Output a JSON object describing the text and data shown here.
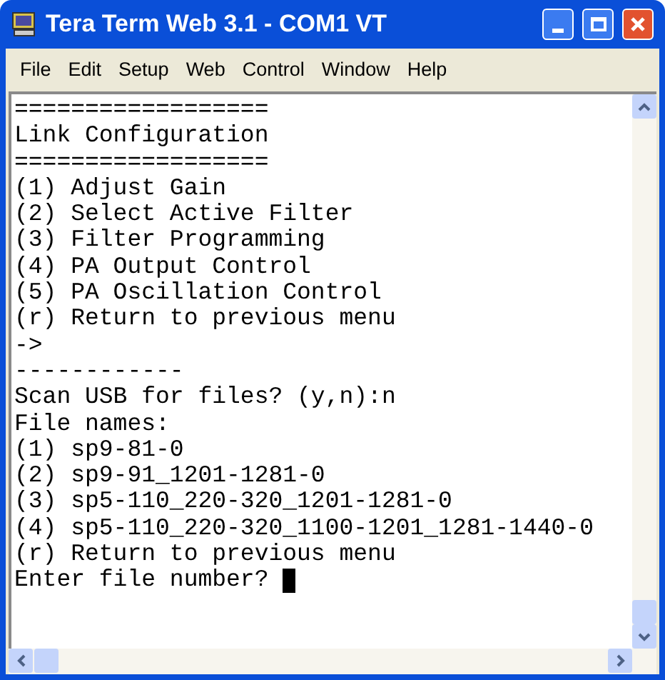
{
  "window": {
    "title": "Tera Term Web 3.1 - COM1 VT"
  },
  "menu": [
    "File",
    "Edit",
    "Setup",
    "Web",
    "Control",
    "Window",
    "Help"
  ],
  "terminal": {
    "lines": [
      "==================",
      "Link Configuration",
      "==================",
      "(1) Adjust Gain",
      "(2) Select Active Filter",
      "(3) Filter Programming",
      "(4) PA Output Control",
      "(5) PA Oscillation Control",
      "(r) Return to previous menu",
      "->",
      "------------",
      "Scan USB for files? (y,n):n",
      "File names:",
      "(1) sp9-81-0",
      "(2) sp9-91_1201-1281-0",
      "(3) sp5-110_220-320_1201-1281-0",
      "(4) sp5-110_220-320_1100-1201_1281-1440-0",
      "(r) Return to previous menu",
      "Enter file number?"
    ],
    "cursor": true
  }
}
